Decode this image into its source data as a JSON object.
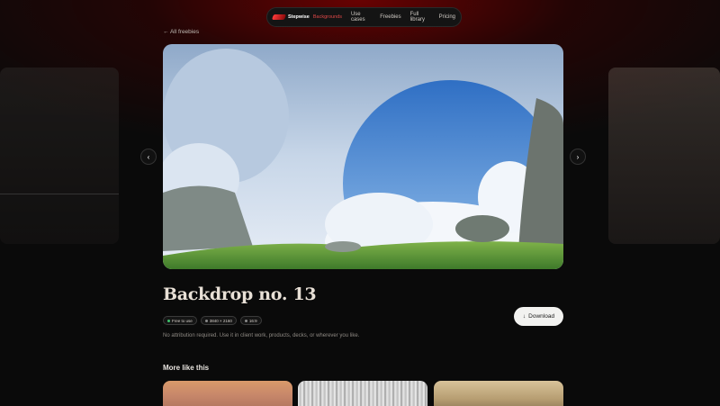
{
  "nav": {
    "brand_name": "Stepwise",
    "brand_sub": "Backgrounds",
    "links": [
      "Use cases",
      "Freebies",
      "Full library",
      "Pricing"
    ]
  },
  "back_link": "← All freebies",
  "arrows": {
    "prev": "‹",
    "next": "›"
  },
  "item": {
    "title": "Backdrop no. 13",
    "tags": [
      "Free to use",
      "3840 × 2160",
      "16:9"
    ],
    "description": "No attribution required. Use it in client work, products, decks, or wherever you like.",
    "download_label": "Download",
    "download_icon": "↓"
  },
  "more": {
    "heading": "More like this"
  },
  "colors": {
    "background": "#0a0a0a",
    "glow": "#780000",
    "tag_dot_green": "#3ec46d"
  }
}
